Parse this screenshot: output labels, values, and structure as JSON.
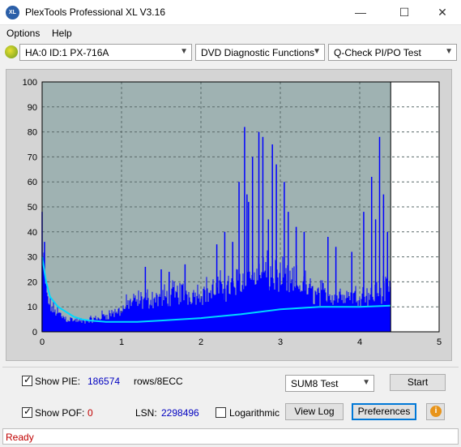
{
  "window": {
    "icon_text": "XL",
    "title": "PlexTools Professional XL V3.16",
    "minimize": "—",
    "maximize": "☐",
    "close": "✕"
  },
  "menu": {
    "items": [
      "Options",
      "Help"
    ]
  },
  "toolbar": {
    "drive": "HA:0 ID:1  PX-716A",
    "function": "DVD Diagnostic Functions",
    "test": "Q-Check PI/PO Test"
  },
  "chart_data": {
    "type": "bar",
    "xlim": [
      0,
      5
    ],
    "ylim": [
      0,
      100
    ],
    "x_ticks": [
      "0",
      "1",
      "2",
      "3",
      "4",
      "5"
    ],
    "y_ticks": [
      "0",
      "10",
      "20",
      "30",
      "40",
      "50",
      "60",
      "70",
      "80",
      "90",
      "100"
    ],
    "grid": true,
    "data_end_x": 4.39,
    "colors": {
      "bars": "#0000ff",
      "average_line": "#00d8ff",
      "plot_bg": "#9fb2b2",
      "end_marker": "#000000"
    },
    "series": [
      {
        "values": [
          [
            0.0,
            48
          ],
          [
            0.05,
            24
          ],
          [
            0.1,
            15
          ],
          [
            0.2,
            11
          ],
          [
            0.3,
            8
          ],
          [
            0.4,
            7
          ],
          [
            0.5,
            6
          ],
          [
            0.6,
            7
          ],
          [
            0.7,
            8
          ],
          [
            0.8,
            10
          ],
          [
            0.9,
            11
          ],
          [
            1.0,
            13
          ],
          [
            1.1,
            17
          ],
          [
            1.2,
            18
          ],
          [
            1.3,
            19
          ],
          [
            1.4,
            20
          ],
          [
            1.5,
            20
          ],
          [
            1.6,
            21
          ],
          [
            1.7,
            22
          ],
          [
            1.8,
            23
          ],
          [
            1.9,
            22
          ],
          [
            2.0,
            23
          ],
          [
            2.1,
            24
          ],
          [
            2.2,
            25
          ],
          [
            2.3,
            26
          ],
          [
            2.4,
            27
          ],
          [
            2.5,
            30
          ],
          [
            2.6,
            33
          ],
          [
            2.7,
            34
          ],
          [
            2.8,
            35
          ],
          [
            2.9,
            32
          ],
          [
            3.0,
            30
          ],
          [
            3.1,
            29
          ],
          [
            3.2,
            28
          ],
          [
            3.3,
            27
          ],
          [
            3.4,
            23
          ],
          [
            3.5,
            22
          ],
          [
            3.6,
            22
          ],
          [
            3.7,
            21
          ],
          [
            3.8,
            22
          ],
          [
            3.9,
            21
          ],
          [
            4.0,
            22
          ],
          [
            4.1,
            22
          ],
          [
            4.2,
            23
          ],
          [
            4.3,
            24
          ],
          [
            4.39,
            27
          ]
        ]
      },
      {
        "values": [
          [
            0.0,
            30
          ],
          [
            0.05,
            20
          ],
          [
            0.1,
            14
          ],
          [
            0.2,
            10
          ],
          [
            0.3,
            8
          ],
          [
            0.4,
            6
          ],
          [
            0.5,
            5
          ],
          [
            0.6,
            4.5
          ],
          [
            0.8,
            4
          ],
          [
            1.0,
            4
          ],
          [
            1.2,
            4
          ],
          [
            1.5,
            4.5
          ],
          [
            2.0,
            5.5
          ],
          [
            2.5,
            7
          ],
          [
            3.0,
            9
          ],
          [
            3.5,
            10
          ],
          [
            4.0,
            10
          ],
          [
            4.39,
            10.5
          ]
        ]
      }
    ],
    "peaks": [
      [
        2.55,
        82
      ],
      [
        2.65,
        70
      ],
      [
        2.73,
        80
      ],
      [
        2.78,
        78
      ],
      [
        2.58,
        55
      ],
      [
        2.48,
        60
      ],
      [
        2.6,
        52
      ],
      [
        2.9,
        75
      ],
      [
        2.95,
        67
      ],
      [
        3.05,
        60
      ],
      [
        3.1,
        48
      ],
      [
        2.85,
        45
      ],
      [
        3.2,
        42
      ],
      [
        3.3,
        40
      ],
      [
        4.25,
        78
      ],
      [
        4.15,
        62
      ],
      [
        4.3,
        55
      ],
      [
        4.05,
        48
      ],
      [
        4.35,
        40
      ],
      [
        4.2,
        45
      ],
      [
        1.3,
        26
      ],
      [
        1.5,
        25
      ],
      [
        1.6,
        24
      ],
      [
        1.8,
        27
      ],
      [
        2.2,
        35
      ],
      [
        2.3,
        40
      ],
      [
        2.4,
        36
      ],
      [
        3.6,
        38
      ],
      [
        3.7,
        34
      ],
      [
        3.9,
        32
      ],
      [
        0.0,
        48
      ],
      [
        0.03,
        36
      ]
    ]
  },
  "controls": {
    "show_pie_label": "Show PIE:",
    "pie_value": "186574",
    "rows_label": "rows/8ECC",
    "show_pof_label": "Show POF:",
    "pof_value": "0",
    "lsn_label": "LSN:",
    "lsn_value": "2298496",
    "logarithmic_label": "Logarithmic",
    "test_select": "SUM8 Test",
    "start_button": "Start",
    "view_log_button": "View Log",
    "preferences_button": "Preferences",
    "info_icon_glyph": "i",
    "show_pie_checked": true,
    "show_pof_checked": true,
    "logarithmic_checked": false
  },
  "status": {
    "text": "Ready"
  }
}
